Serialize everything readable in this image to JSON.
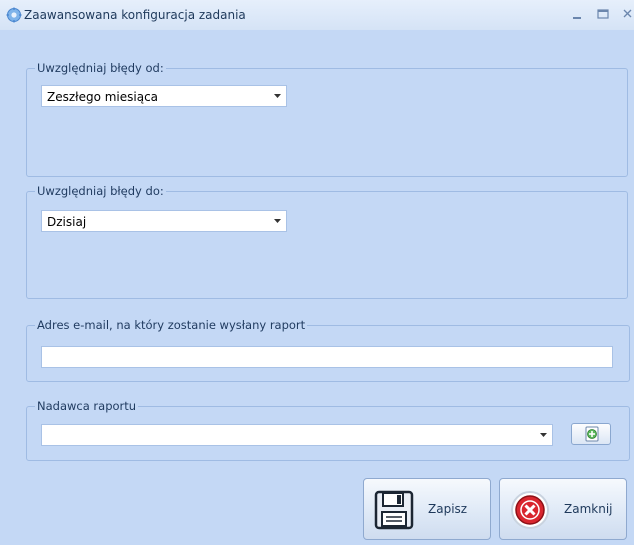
{
  "window": {
    "title": "Zaawansowana konfiguracja zadania",
    "minimize_symbol": "_",
    "maximize_symbol": "□",
    "close_symbol": "×"
  },
  "from_group": {
    "legend": "Uwzględniaj błędy od:",
    "selected": "Zeszłego miesiąca"
  },
  "to_group": {
    "legend": "Uwzględniaj błędy do:",
    "selected": "Dzisiaj"
  },
  "email_group": {
    "legend": "Adres e-mail, na który zostanie wysłany raport",
    "value": ""
  },
  "sender_group": {
    "legend": "Nadawca raportu",
    "selected": ""
  },
  "buttons": {
    "save_label": "Zapisz",
    "close_label": "Zamknij"
  },
  "colors": {
    "form_background": "#c4d8f5",
    "group_border": "#9fbbe3",
    "close_icon_red": "#d9262e"
  },
  "icons": {
    "app": "gear-icon",
    "save": "floppy-disk-icon",
    "close": "close-circle-icon",
    "add_sender": "add-icon",
    "dropdown": "chevron-down-icon"
  }
}
